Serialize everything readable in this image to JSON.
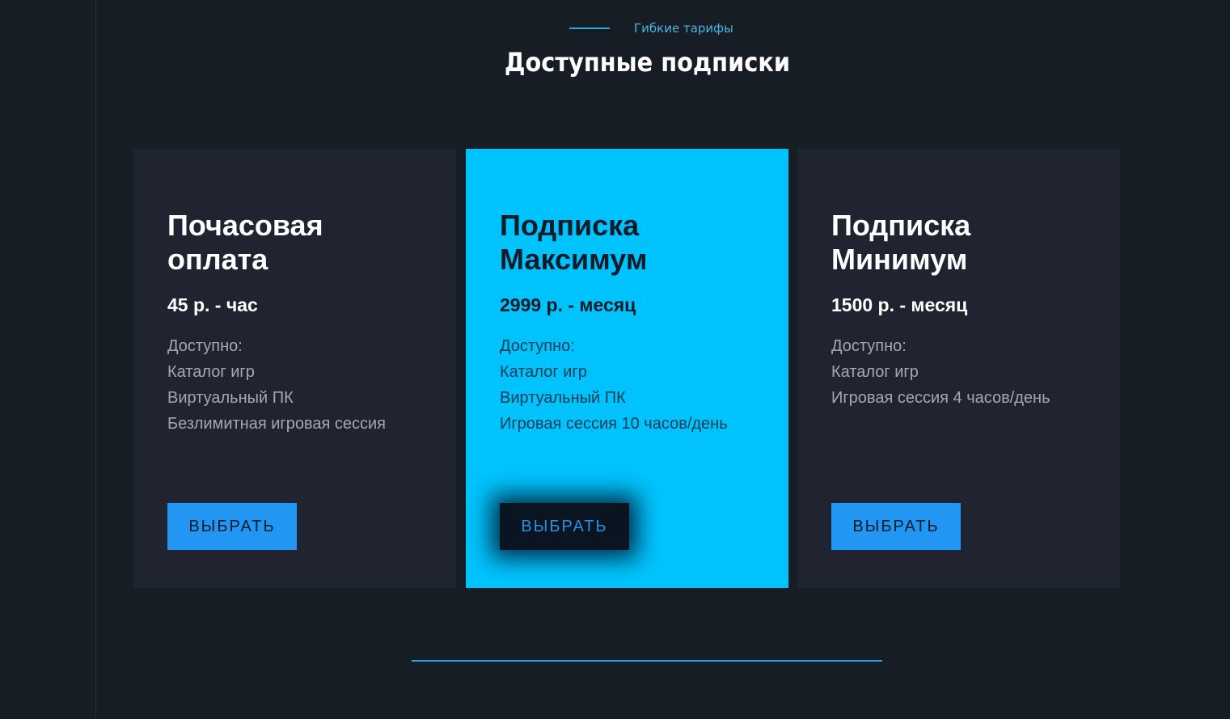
{
  "section": {
    "eyebrow": "Гибкие тарифы",
    "title": "Доступные подписки"
  },
  "plans": [
    {
      "title": "Почасовая\nоплата",
      "price": "45 р. - час",
      "features": [
        "Доступно:",
        "Каталог игр",
        "Виртуальный ПК",
        "Безлимитная игровая сессия"
      ],
      "button": "ВЫБРАТЬ"
    },
    {
      "title": "Подписка\nМаксимум",
      "price": "2999 р. - месяц",
      "features": [
        "Доступно:",
        "Каталог игр",
        "Виртуальный ПК",
        "Игровая сессия 10 часов/день"
      ],
      "button": "ВЫБРАТЬ"
    },
    {
      "title": "Подписка\nМинимум",
      "price": "1500 р. - месяц",
      "features": [
        "Доступно:",
        "Каталог игр",
        "Игровая сессия 4 часов/день"
      ],
      "button": "ВЫБРАТЬ"
    }
  ],
  "colors": {
    "background": "#171d25",
    "card": "#1f2430",
    "featured_card": "#00c3fd",
    "accent": "#2196f3",
    "line": "#2ba7db"
  }
}
